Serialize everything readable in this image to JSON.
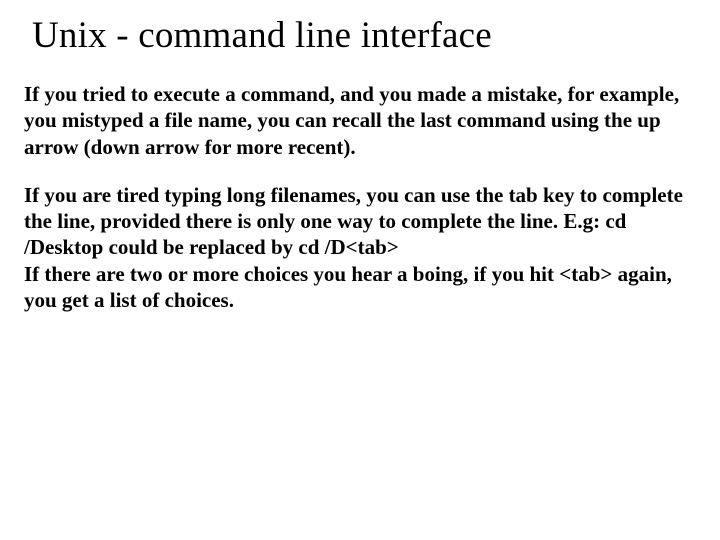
{
  "title": "Unix - command line interface",
  "paragraph1": "If you tried to execute a command, and you made a mistake, for example, you mistyped a file name, you can recall the last command using the up arrow (down arrow for more recent).",
  "paragraph2": "If you are tired typing long filenames, you can use the tab key to complete the line, provided there is only one way to complete the line.  E.g:  cd /Desktop could be replaced by cd /D<tab>\nIf there are two or more choices you hear a boing, if you hit <tab> again, you get a list of choices."
}
